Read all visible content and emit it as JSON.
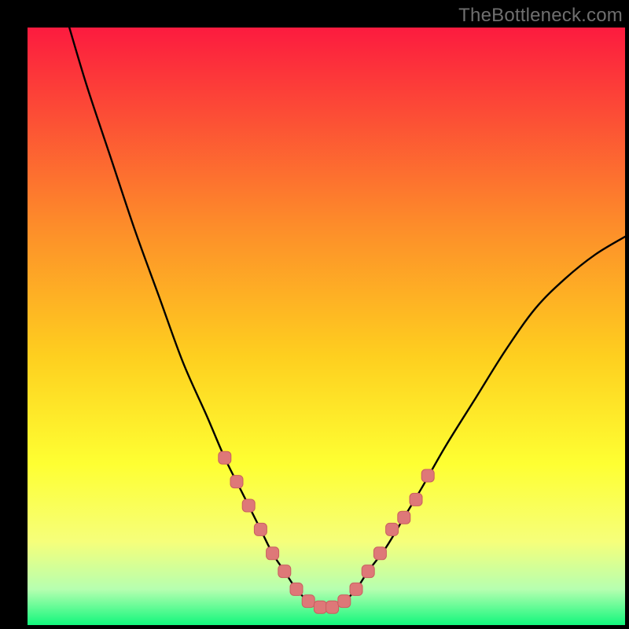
{
  "watermark": "TheBottleneck.com",
  "colors": {
    "bg": "#000000",
    "gradient_top": "#fc1b3f",
    "gradient_mid1": "#fd7c2c",
    "gradient_mid2": "#fecf1f",
    "gradient_mid3": "#feff32",
    "gradient_mid4": "#e7ff6d",
    "gradient_bottom": "#12f77c",
    "curve": "#000000",
    "marker_fill": "#de7878",
    "marker_stroke": "#c95f5f",
    "watermark": "#6f6f6f"
  },
  "chart_data": {
    "type": "line",
    "title": "",
    "xlabel": "",
    "ylabel": "",
    "xlim": [
      0,
      100
    ],
    "ylim": [
      0,
      100
    ],
    "series": [
      {
        "name": "bottleneck-curve",
        "x": [
          7,
          10,
          14,
          18,
          22,
          26,
          30,
          33,
          36,
          39,
          41,
          43,
          45,
          47,
          49,
          51,
          53,
          55,
          57,
          60,
          63,
          66,
          70,
          75,
          80,
          85,
          90,
          95,
          100
        ],
        "values": [
          100,
          90,
          78,
          66,
          55,
          44,
          35,
          28,
          22,
          16,
          12,
          9,
          6,
          4,
          3,
          3,
          4,
          6,
          9,
          13,
          18,
          23,
          30,
          38,
          46,
          53,
          58,
          62,
          65
        ]
      }
    ],
    "markers": {
      "name": "highlighted-points",
      "x": [
        33,
        35,
        37,
        39,
        41,
        43,
        45,
        47,
        49,
        51,
        53,
        55,
        57,
        59,
        61,
        63,
        65,
        67
      ],
      "values": [
        28,
        24,
        20,
        16,
        12,
        9,
        6,
        4,
        3,
        3,
        4,
        6,
        9,
        12,
        16,
        18,
        21,
        25
      ]
    }
  }
}
